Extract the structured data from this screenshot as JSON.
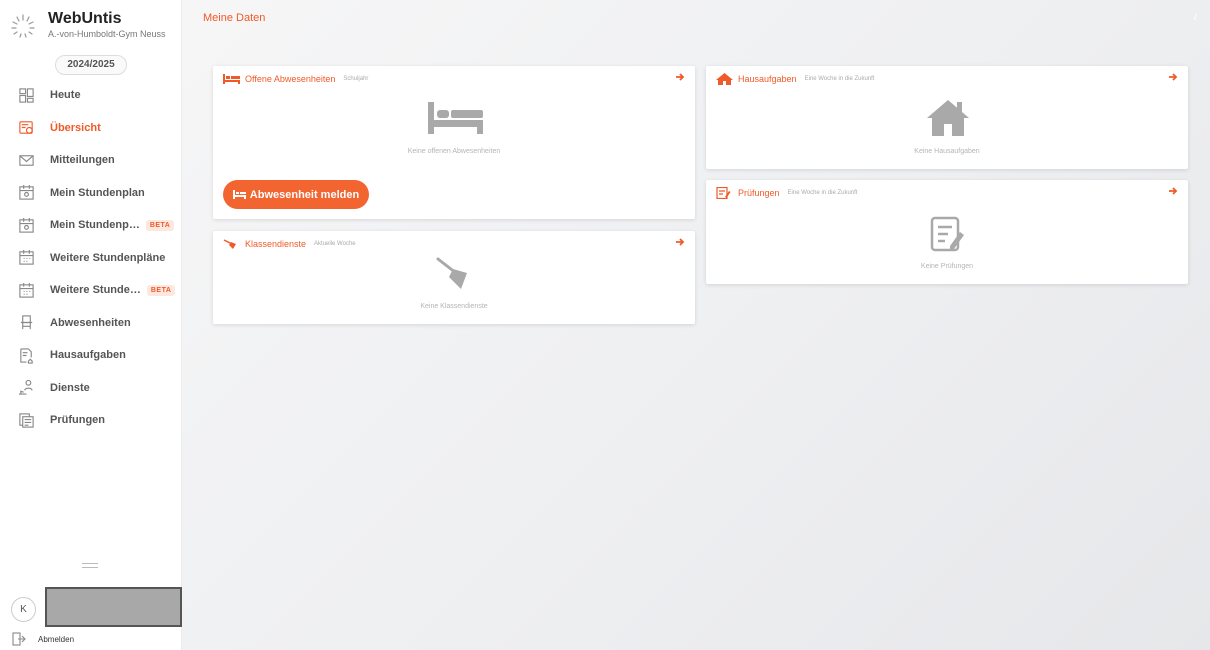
{
  "brand": {
    "name": "WebUntis",
    "school": "A.-von-Humboldt-Gym Neuss"
  },
  "school_year": "2024/2025",
  "nav": [
    {
      "label": "Heute",
      "icon": "dashboard-icon",
      "active": false,
      "beta": ""
    },
    {
      "label": "Übersicht",
      "icon": "overview-icon",
      "active": true,
      "beta": ""
    },
    {
      "label": "Mitteilungen",
      "icon": "mail-icon",
      "active": false,
      "beta": ""
    },
    {
      "label": "Mein Stundenplan",
      "icon": "calendar-user-icon",
      "active": false,
      "beta": ""
    },
    {
      "label": "Mein Stundenp…",
      "icon": "calendar-user-icon",
      "active": false,
      "beta": "BETA"
    },
    {
      "label": "Weitere Stundenpläne",
      "icon": "calendar-grid-icon",
      "active": false,
      "beta": ""
    },
    {
      "label": "Weitere Stunde…",
      "icon": "calendar-grid-icon",
      "active": false,
      "beta": "BETA"
    },
    {
      "label": "Abwesenheiten",
      "icon": "chair-icon",
      "active": false,
      "beta": ""
    },
    {
      "label": "Hausaufgaben",
      "icon": "homework-icon",
      "active": false,
      "beta": ""
    },
    {
      "label": "Dienste",
      "icon": "duty-icon",
      "active": false,
      "beta": ""
    },
    {
      "label": "Prüfungen",
      "icon": "exams-icon",
      "active": false,
      "beta": ""
    }
  ],
  "user": {
    "initial": "K"
  },
  "logout_label": "Abmelden",
  "page_title": "Meine Daten",
  "cards": {
    "absences": {
      "title": "Offene Abwesenheiten",
      "subtitle": "Schuljahr",
      "empty": "Keine offenen Abwesenheiten",
      "button": "Abwesenheit melden"
    },
    "duties": {
      "title": "Klassendienste",
      "subtitle": "Aktuelle Woche",
      "empty": "Keine Klassendienste"
    },
    "homework": {
      "title": "Hausaufgaben",
      "subtitle": "Eine Woche in die Zukunft",
      "empty": "Keine Hausaufgaben"
    },
    "exams": {
      "title": "Prüfungen",
      "subtitle": "Eine Woche in die Zukunft",
      "empty": "Keine Prüfungen"
    }
  },
  "colors": {
    "accent": "#f05a28",
    "button": "#f26430",
    "muted_icon": "#a9a9a9"
  }
}
